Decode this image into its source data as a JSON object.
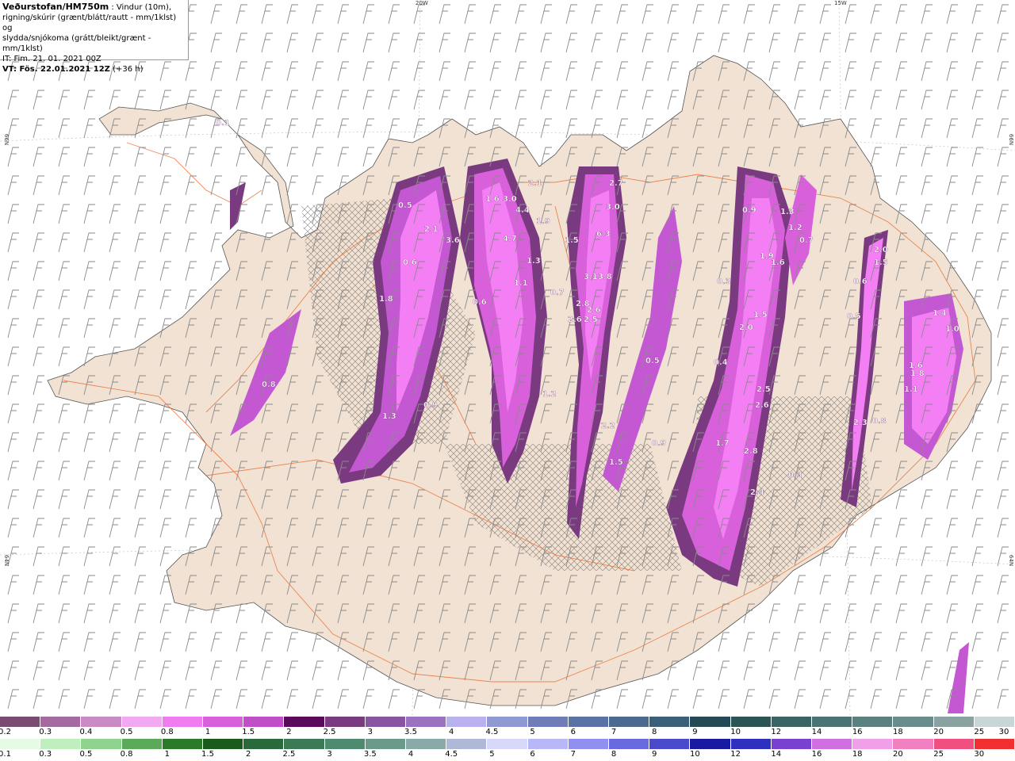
{
  "header": {
    "title": "Veðurstofan/HM750m",
    "line1": ": Vindur (10m),",
    "line2": "rigning/skúrir (grænt/blátt/rautt - mm/1klst) og",
    "line3": "slydda/snjókoma (grátt/bleikt/grænt - mm/1klst)",
    "it": "IT: Fim. 21. 01. 2021 00Z",
    "vt": "VT: Fös. 22.01.2021 12Z",
    "vt_suffix": "(+36 h)"
  },
  "coords": {
    "top_left_lon": "20W",
    "top_right_lon": "15W",
    "left_upper_lat": "66N",
    "right_upper_lat": "66N",
    "left_lower_lat": "64N",
    "right_lower_lat": "64N"
  },
  "colors": {
    "sea": "#ffffff",
    "land": "#f2e2d3",
    "roads": "#e8743a",
    "snow_light": "#f47ff4",
    "snow_mid": "#c458d2",
    "snow_dark": "#7a3a80",
    "wind_barb": "#8a8a8a"
  },
  "snow_legend": {
    "labels": [
      "0.2",
      "0.3",
      "0.4",
      "0.5",
      "0.8",
      "1",
      "1.5",
      "2",
      "2.5",
      "3",
      "3.5",
      "4",
      "4.5",
      "5",
      "6",
      "7",
      "8",
      "9",
      "10",
      "12",
      "14",
      "16",
      "18",
      "20",
      "25",
      "30"
    ],
    "colors": [
      "#7b4a73",
      "#a56aa0",
      "#c98ac6",
      "#f3a9f1",
      "#f07cf0",
      "#d860da",
      "#c04fc7",
      "#5a0a5a",
      "#7a3a80",
      "#8a55a0",
      "#9a72bf",
      "#b9b0ee",
      "#8f9ad4",
      "#6f7cb8",
      "#5a72a4",
      "#4a6b8f",
      "#3a5f79",
      "#234a55",
      "#2b5555",
      "#3a6464",
      "#4a7474",
      "#5a8080",
      "#6b8c8c",
      "#8aa2a2",
      "#c8d6d6"
    ]
  },
  "rain_legend": {
    "labels": [
      "0.1",
      "0.3",
      "0.5",
      "0.8",
      "1",
      "1.5",
      "2",
      "2.5",
      "3",
      "3.5",
      "4",
      "4.5",
      "5",
      "6",
      "7",
      "8",
      "9",
      "10",
      "12",
      "14",
      "16",
      "18",
      "20",
      "25",
      "30"
    ],
    "colors": [
      "#e5fbe5",
      "#bfefbf",
      "#8fd38f",
      "#5aaa5a",
      "#2a7a2a",
      "#1a5a1a",
      "#2a6a3a",
      "#3b7a55",
      "#4d8a70",
      "#6a9a8a",
      "#8aaaa8",
      "#b0b8d8",
      "#d8d8f8",
      "#b8b8f8",
      "#9090f0",
      "#6a6ae0",
      "#4a4acc",
      "#1a1aa0",
      "#3030c0",
      "#7a40d0",
      "#d070e0",
      "#f0a0e8",
      "#f080c0",
      "#f05080",
      "#f03030"
    ]
  },
  "precip_labels": [
    "0.1",
    "0.5",
    "2.1",
    "3.6",
    "0.6",
    "1.6",
    "3.0",
    "4.4",
    "4.7",
    "1.3",
    "1.1",
    "1.9",
    "2.1",
    "2.7",
    "3.0",
    "6.3",
    "3.1",
    "3.8",
    "2.8",
    "2.6",
    "2.5",
    "1.5",
    "0.7",
    "0.6",
    "2.6",
    "1.8",
    "1.3",
    "0.9",
    "1.2",
    "2.2",
    "1.5",
    "0.9",
    "0.5",
    "0.8",
    "2.5",
    "2.6",
    "1.7",
    "2.8",
    "2.4",
    "2.0",
    "1.5",
    "0.9",
    "0.4",
    "0.3",
    "1.9",
    "1.6",
    "1.2",
    "0.7",
    "1.3",
    "1.4",
    "0.6",
    "0.5",
    "2.0",
    "1.5",
    "1.6",
    "2.3",
    "0.8",
    "1.0",
    "1.8",
    "1.1",
    "0.3"
  ]
}
